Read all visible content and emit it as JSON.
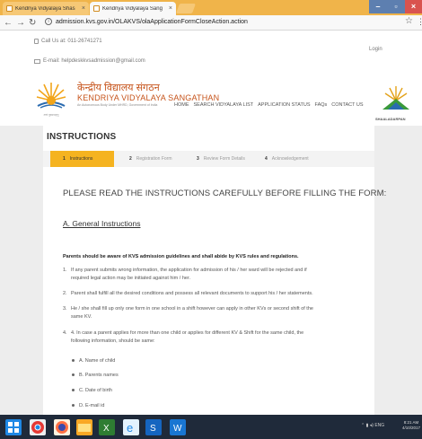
{
  "browser": {
    "tabs": [
      {
        "label": "Kendriya Vidyalaya Shas"
      },
      {
        "label": "Kendriya Vidyalaya Sang"
      }
    ],
    "url": "admission.kvs.gov.in/OLAKVS/olaApplicationFormCloseAction.action"
  },
  "topbar": {
    "call": "Call Us at: 011-26741271",
    "email": "E-mail: helpdeskkvsadmission@gmail.com",
    "login": "Login"
  },
  "header": {
    "motto": "तत्त्वं पूषन्नपावृणु",
    "brand_hindi": "केन्द्रीय विद्यालय संगठन",
    "brand_english": "KENDRIYA VIDYALAYA SANGATHAN",
    "brand_sub": "An Autonomous Body Under MHRD, Government of India",
    "nav": [
      "HOME",
      "SEARCH VIDYALAYA LIST",
      "APPLICATION STATUS",
      "FAQs",
      "CONTACT US"
    ],
    "shala_label": "SHAALADARPAN"
  },
  "content": {
    "title": "INSTRUCTIONS",
    "steps": [
      {
        "num": "1",
        "label": "Instructions"
      },
      {
        "num": "2",
        "label": "Registration Form"
      },
      {
        "num": "3",
        "label": "Review Form Details"
      },
      {
        "num": "4",
        "label": "Acknowledgement"
      }
    ],
    "heading": "PLEASE READ THE INSTRUCTIONS CAREFULLY BEFORE FILLING THE FORM:",
    "subheading": "A. General Instructions",
    "lead": "Parents should be aware of KVS admission guidelines and shall abide by KVS rules and regulations.",
    "items": [
      {
        "n": "1.",
        "l1": "If any parent submits wrong information, the application for admission of his / her ward will be rejected and if",
        "l2": "required legal action may be initiated against him / her."
      },
      {
        "n": "2.",
        "l1": "Parent shall fulfill all the desired conditions and possess all relevant documents to support his / her statements.",
        "l2": ""
      },
      {
        "n": "3.",
        "l1": "He / she shall fill up only one form in one school in a shift however can apply in other KVs or second shift of the",
        "l2": "same KV."
      },
      {
        "n": "4.",
        "l1": "4. In case a parent applies for more than one child or applies for different KV & Shift for the same child, the",
        "l2": "following information, should be same:"
      }
    ],
    "bullets": [
      "A. Name of child",
      "B. Parents names",
      "C. Date of birth",
      "D. E-mail id"
    ]
  },
  "taskbar": {
    "tray": "ENG",
    "time": "8:21 AM",
    "date": "4/10/2017"
  }
}
